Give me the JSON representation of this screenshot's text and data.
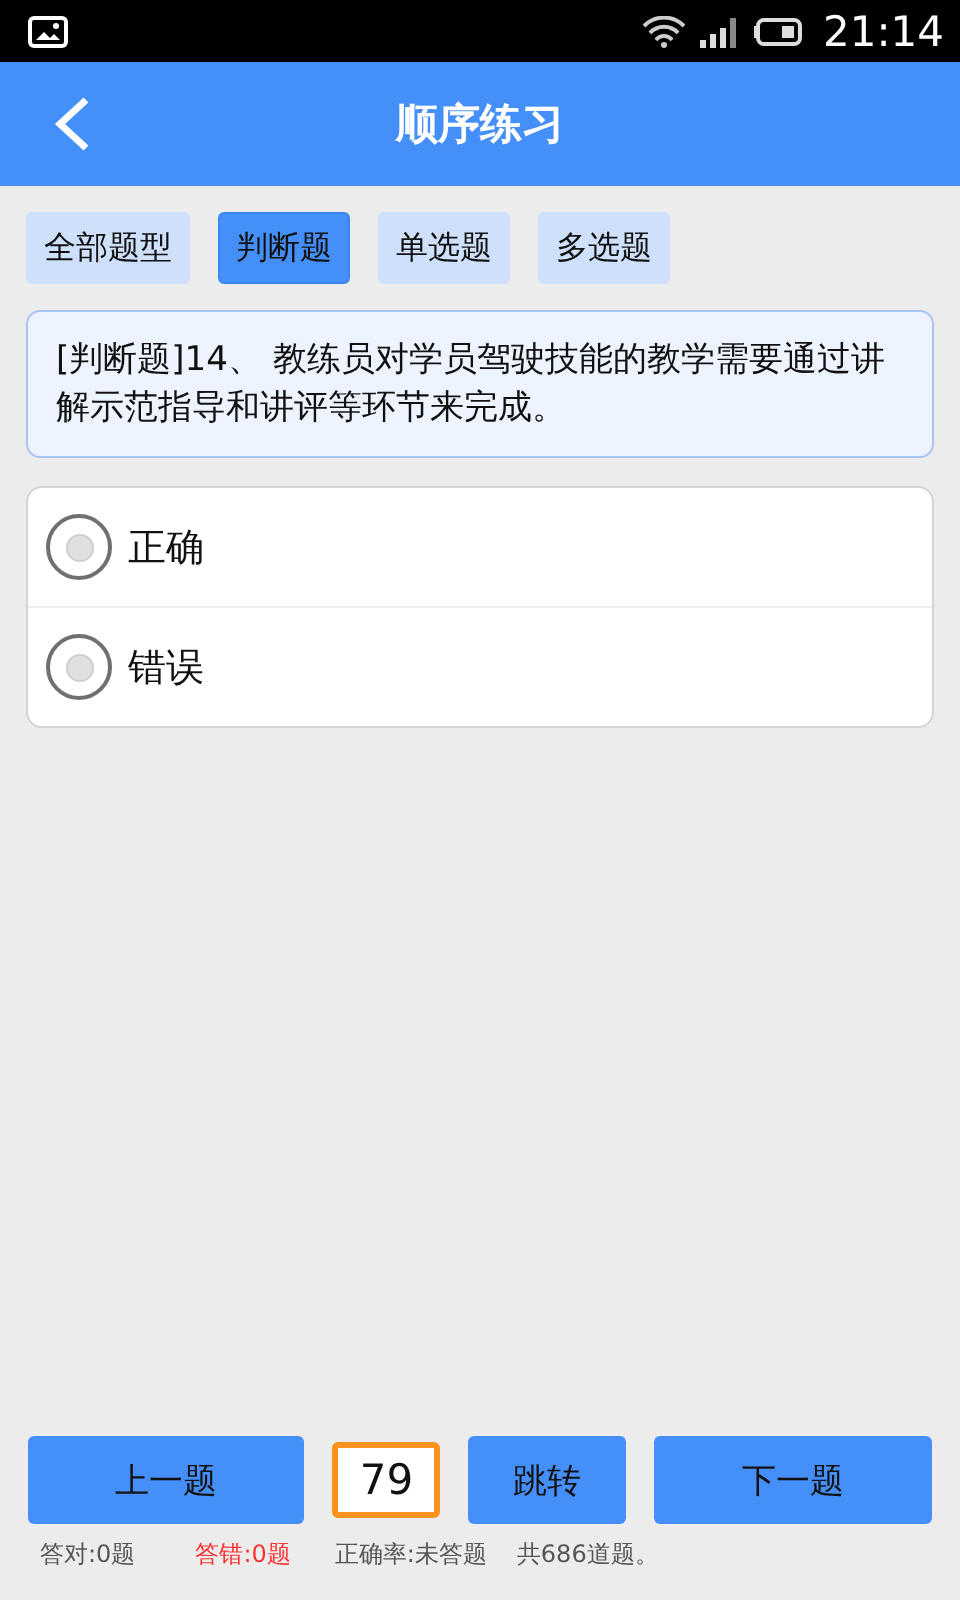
{
  "status_bar": {
    "time": "21:14"
  },
  "header": {
    "title": "顺序练习"
  },
  "tabs": [
    {
      "label": "全部题型",
      "selected": false
    },
    {
      "label": "判断题",
      "selected": true
    },
    {
      "label": "单选题",
      "selected": false
    },
    {
      "label": "多选题",
      "selected": false
    }
  ],
  "question": {
    "text": "[判断题]14、 教练员对学员驾驶技能的教学需要通过讲解示范指导和讲评等环节来完成。"
  },
  "options": [
    {
      "label": "正确",
      "selected": false
    },
    {
      "label": "错误",
      "selected": false
    }
  ],
  "navigation": {
    "prev": "上一题",
    "jump_value": "79",
    "jump": "跳转",
    "next": "下一题"
  },
  "stats": [
    {
      "text": "答对:0题",
      "color": "#555555"
    },
    {
      "text": "答错:0题",
      "color": "#ff3333"
    },
    {
      "text": "正确率:未答题",
      "color": "#555555"
    },
    {
      "text": "共686道题。",
      "color": "#555555"
    }
  ]
}
